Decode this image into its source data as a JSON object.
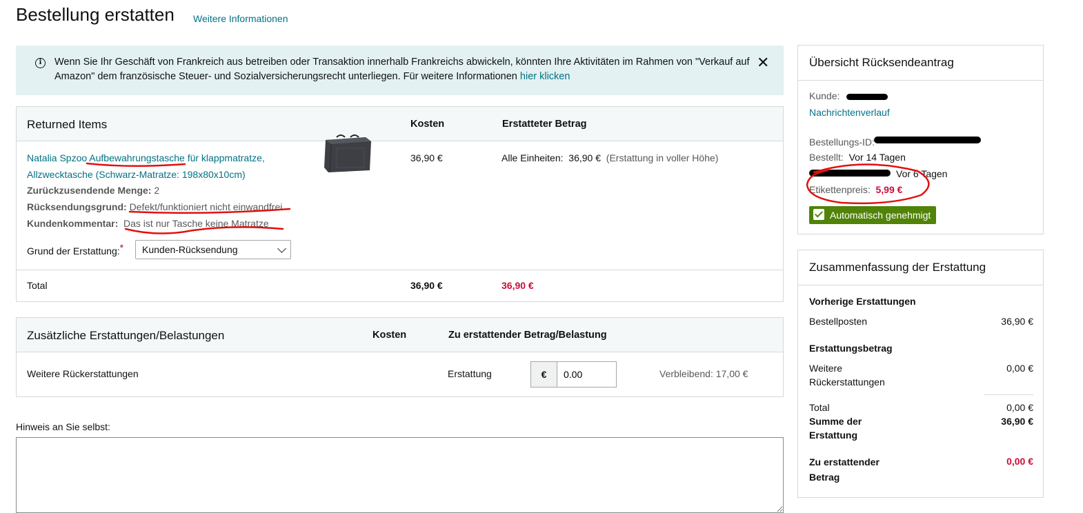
{
  "page": {
    "title": "Bestellung erstatten",
    "more_info_link": "Weitere Informationen"
  },
  "banner": {
    "text": "Wenn Sie Ihr Geschäft von Frankreich aus betreiben oder Transaktion innerhalb Frankreichs abwickeln, könnten Ihre Aktivitäten im Rahmen von \"Verkauf auf Amazon\" dem französische Steuer- und Sozialversicherungsrecht unterliegen. Für weitere Informationen",
    "link": "hier klicken",
    "close_icon": "close-icon"
  },
  "returned_items": {
    "title": "Returned Items",
    "col_cost": "Kosten",
    "col_refunded": "Erstatteter Betrag",
    "product_name": "Natalia Spzoo Aufbewahrungstasche für klappmatratze, Allzwecktasche (Schwarz-Matratze: 198x80x10cm)",
    "qty_label": "Zurückzusendende Menge:",
    "qty_value": "2",
    "reason_label": "Rücksendungsgrund:",
    "reason_value": "Defekt/funktioniert nicht einwandfrei",
    "comment_label": "Kundenkommentar:",
    "comment_value": "Das ist nur Tasche keine Matratze",
    "refund_reason_label": "Grund der Erstattung:",
    "refund_reason_required": "*",
    "refund_reason_value": "Kunden-Rücksendung",
    "cost": "36,90 €",
    "units_label": "Alle Einheiten:",
    "units_amount": "36,90 €",
    "units_note": "(Erstattung in voller Höhe)",
    "total_label": "Total",
    "total_cost": "36,90 €",
    "total_refund": "36,90 €"
  },
  "additional": {
    "title": "Zusätzliche Erstattungen/Belastungen",
    "col_cost": "Kosten",
    "col_amount": "Zu erstattender Betrag/Belastung",
    "row_label": "Weitere Rückerstattungen",
    "row_type": "Erstattung",
    "currency": "€",
    "amount_value": "0.00",
    "remaining": "Verbleibend: 17,00 €"
  },
  "note": {
    "label": "Hinweis an Sie selbst:"
  },
  "overview": {
    "title": "Übersicht Rücksendeantrag",
    "customer_label": "Kunde:",
    "message_history": "Nachrichtenverlauf",
    "order_id_label": "Bestellungs-ID:",
    "ordered_label": "Bestellt:",
    "ordered_value": "Vor 14 Tagen",
    "returned_value": "Vor 6 Tagen",
    "label_price_label": "Etikettenpreis:",
    "label_price_value": "5,99 €",
    "auto_approved": "Automatisch genehmigt"
  },
  "summary": {
    "title": "Zusammenfassung der Erstattung",
    "prev_heading": "Vorherige Erstattungen",
    "prev_item_label": "Bestellposten",
    "prev_item_value": "36,90 €",
    "refund_heading": "Erstattungsbetrag",
    "more_refunds_label": "Weitere Rückerstattungen",
    "more_refunds_value": "0,00 €",
    "total_label": "Total",
    "total_value": "0,00 €",
    "sum_label": "Summe der Erstattung",
    "sum_value": "36,90 €",
    "to_refund_label": "Zu erstattender Betrag",
    "to_refund_value": "0,00 €"
  },
  "colors": {
    "link": "#007185",
    "banner_bg": "#e3f1f2",
    "approved_green": "#508308",
    "price_red": "#cc0c39",
    "annotation_red": "#e01010"
  }
}
